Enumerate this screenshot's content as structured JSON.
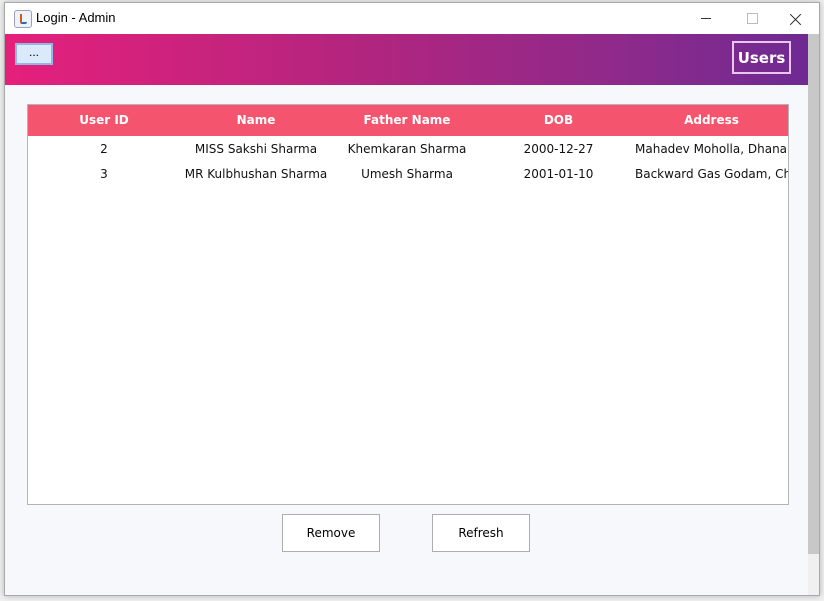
{
  "window": {
    "title": "Login - Admin"
  },
  "header": {
    "menu_button_label": "...",
    "badge_label": "Users",
    "gradient_colors": [
      "#e5207b",
      "#6e2a92"
    ]
  },
  "table": {
    "header_color": "#f4546e",
    "columns": [
      "User ID",
      "Name",
      "Father Name",
      "DOB",
      "Address"
    ],
    "rows": [
      [
        "2",
        "MISS Sakshi Sharma",
        "Khemkaran Sharma",
        "2000-12-27",
        "Mahadev Moholla, Dhana..."
      ],
      [
        "3",
        "MR Kulbhushan Sharma",
        "Umesh Sharma",
        "2001-01-10",
        "Backward Gas Godam, Ch..."
      ]
    ]
  },
  "actions": {
    "remove_label": "Remove",
    "refresh_label": "Refresh"
  }
}
